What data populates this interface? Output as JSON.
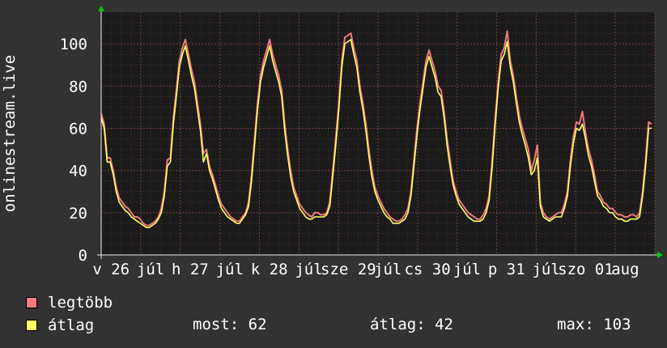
{
  "chart_data": {
    "type": "line",
    "ylabel": "onlinestream.live",
    "ylim": [
      0,
      115
    ],
    "yticks": [
      0,
      20,
      40,
      60,
      80,
      100
    ],
    "grid": true,
    "x_tick_labels": [
      "v 26",
      "júl",
      "h 27",
      "júl",
      "k 28",
      "júl",
      "sze 29",
      "júl",
      "cs 30",
      "júl",
      "p 31",
      "júl",
      "szo 01",
      "aug"
    ],
    "legend": {
      "placement": "bottom-left",
      "entries": [
        {
          "name": "legtöbb",
          "color": "#ff7a80"
        },
        {
          "name": "átlag",
          "color": "#ffff66"
        }
      ]
    },
    "series": [
      {
        "name": "legtöbb",
        "color": "#f07a7a",
        "values": [
          67,
          62,
          46,
          46,
          40,
          32,
          27,
          25,
          23,
          22,
          20,
          18,
          18,
          17,
          15,
          14,
          14,
          15,
          16,
          18,
          22,
          30,
          45,
          46,
          65,
          78,
          92,
          98,
          102,
          95,
          88,
          82,
          72,
          62,
          48,
          50,
          42,
          38,
          33,
          28,
          24,
          22,
          20,
          18,
          17,
          16,
          16,
          18,
          20,
          25,
          38,
          55,
          72,
          85,
          92,
          97,
          102,
          95,
          90,
          85,
          78,
          62,
          50,
          40,
          32,
          28,
          24,
          22,
          20,
          19,
          18,
          20,
          20,
          19,
          19,
          20,
          25,
          40,
          55,
          72,
          92,
          103,
          104,
          105,
          98,
          92,
          80,
          72,
          62,
          50,
          40,
          32,
          28,
          25,
          22,
          20,
          18,
          17,
          16,
          16,
          17,
          19,
          22,
          30,
          45,
          60,
          72,
          82,
          92,
          97,
          92,
          87,
          80,
          78,
          68,
          55,
          45,
          35,
          30,
          26,
          24,
          22,
          20,
          19,
          18,
          17,
          17,
          19,
          22,
          28,
          45,
          65,
          82,
          95,
          98,
          106,
          92,
          85,
          75,
          66,
          60,
          55,
          50,
          40,
          45,
          52,
          25,
          20,
          18,
          17,
          18,
          19,
          20,
          20,
          24,
          30,
          45,
          56,
          63,
          62,
          68,
          58,
          50,
          45,
          38,
          30,
          28,
          25,
          24,
          22,
          22,
          20,
          19,
          19,
          18,
          18,
          19,
          19,
          18,
          20,
          30,
          45,
          63,
          62
        ]
      },
      {
        "name": "átlag",
        "color": "#ffff66",
        "values": [
          65,
          60,
          44,
          44,
          38,
          30,
          25,
          23,
          21,
          20,
          18,
          17,
          16,
          15,
          14,
          13,
          13,
          14,
          15,
          17,
          20,
          28,
          42,
          44,
          62,
          75,
          89,
          95,
          99,
          92,
          85,
          79,
          69,
          59,
          44,
          48,
          40,
          36,
          31,
          26,
          22,
          20,
          18,
          17,
          16,
          15,
          15,
          17,
          19,
          23,
          35,
          52,
          69,
          82,
          89,
          94,
          99,
          92,
          87,
          82,
          75,
          59,
          47,
          37,
          30,
          26,
          22,
          20,
          18,
          17,
          17,
          18,
          18,
          18,
          18,
          19,
          23,
          37,
          52,
          69,
          89,
          100,
          101,
          102,
          95,
          89,
          77,
          69,
          59,
          47,
          37,
          30,
          26,
          23,
          20,
          18,
          17,
          15,
          15,
          15,
          16,
          17,
          20,
          28,
          42,
          57,
          69,
          79,
          89,
          94,
          89,
          84,
          77,
          75,
          65,
          52,
          42,
          33,
          28,
          24,
          22,
          20,
          18,
          17,
          16,
          16,
          16,
          17,
          20,
          26,
          42,
          62,
          79,
          92,
          95,
          101,
          89,
          82,
          72,
          63,
          57,
          52,
          46,
          38,
          40,
          46,
          23,
          18,
          17,
          16,
          17,
          18,
          18,
          18,
          22,
          28,
          42,
          53,
          60,
          59,
          62,
          55,
          47,
          42,
          35,
          28,
          26,
          23,
          22,
          20,
          20,
          18,
          17,
          17,
          16,
          16,
          17,
          17,
          17,
          18,
          28,
          42,
          60,
          60
        ]
      }
    ]
  },
  "stats": {
    "most": "most: 62",
    "atlag": "átlag: 42",
    "max": "max: 103"
  }
}
